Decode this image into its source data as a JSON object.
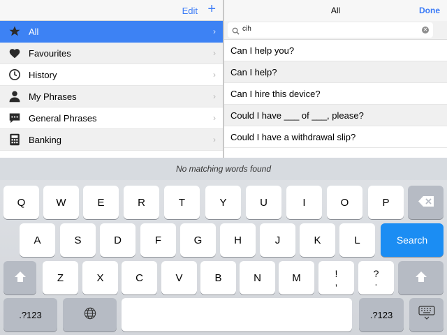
{
  "left_header": {
    "edit_label": "Edit",
    "add_label": "+"
  },
  "categories": [
    {
      "label": "All",
      "icon": "star-icon"
    },
    {
      "label": "Favourites",
      "icon": "heart-icon"
    },
    {
      "label": "History",
      "icon": "clock-icon"
    },
    {
      "label": "My Phrases",
      "icon": "person-icon"
    },
    {
      "label": "General Phrases",
      "icon": "speech-bubble-icon"
    },
    {
      "label": "Banking",
      "icon": "calculator-icon"
    }
  ],
  "chevron": "›",
  "right_header": {
    "title": "All",
    "done_label": "Done"
  },
  "search": {
    "value": "cih",
    "clear": "✕"
  },
  "phrases": [
    "Can I help you?",
    "Can I help?",
    "Can I hire this device?",
    "Could I have ___ of ___, please?",
    "Could I have a withdrawal slip?"
  ],
  "keyboard": {
    "suggestion_text": "No matching words found",
    "row1": [
      "Q",
      "W",
      "E",
      "R",
      "T",
      "Y",
      "U",
      "I",
      "O",
      "P"
    ],
    "row2": [
      "A",
      "S",
      "D",
      "F",
      "G",
      "H",
      "J",
      "K",
      "L"
    ],
    "row3": [
      "Z",
      "X",
      "C",
      "V",
      "B",
      "N",
      "M"
    ],
    "punct1": [
      "!",
      ","
    ],
    "punct2": [
      "?",
      "."
    ],
    "search_label": "Search",
    "numbers_label": ".?123",
    "accent_color": "#1b8df3"
  }
}
